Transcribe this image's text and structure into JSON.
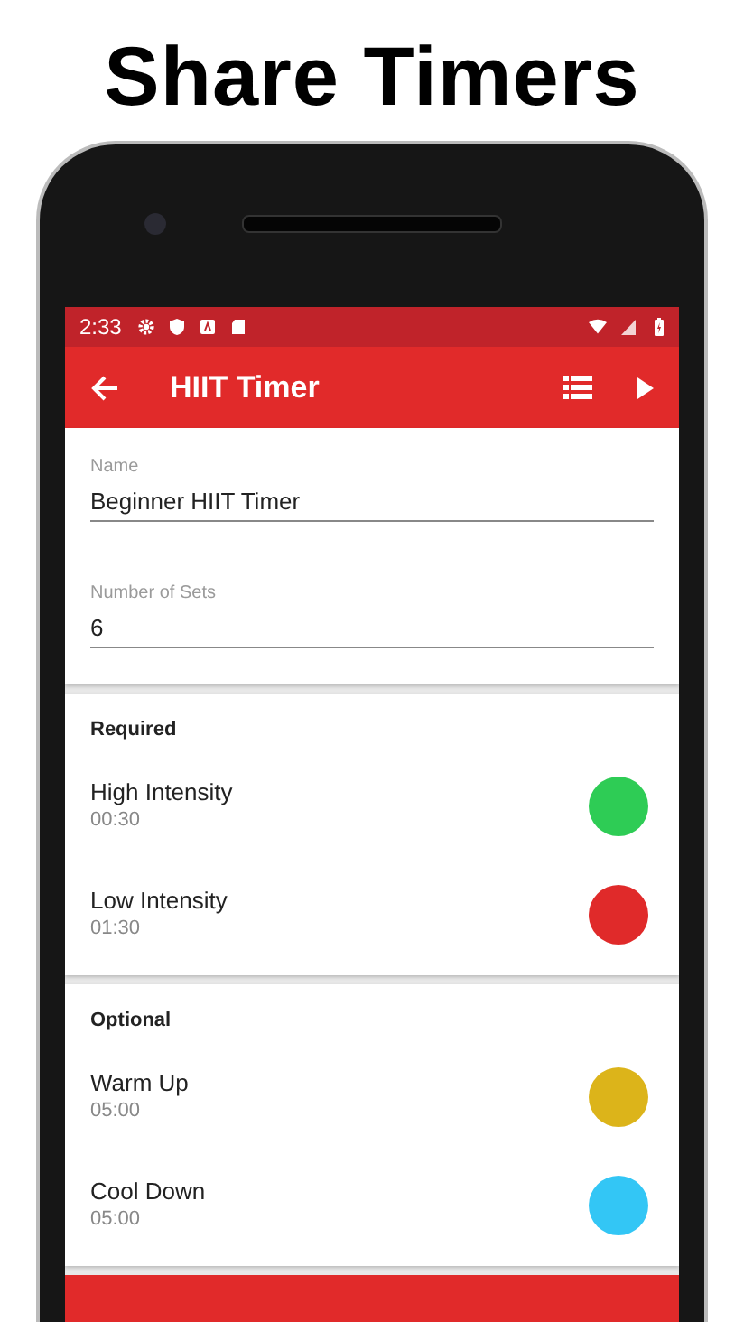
{
  "headline": "Share Timers",
  "status_bar": {
    "time": "2:33"
  },
  "app_bar": {
    "title": "HIIT Timer"
  },
  "fields": [
    {
      "label": "Name",
      "value": "Beginner HIIT Timer"
    },
    {
      "label": "Number of Sets",
      "value": "6"
    }
  ],
  "sections": [
    {
      "title": "Required",
      "items": [
        {
          "name": "High Intensity",
          "time": "00:30",
          "color": "#2ecc55"
        },
        {
          "name": "Low Intensity",
          "time": "01:30",
          "color": "#e02a2a"
        }
      ]
    },
    {
      "title": "Optional",
      "items": [
        {
          "name": "Warm Up",
          "time": "05:00",
          "color": "#dcb41a"
        },
        {
          "name": "Cool Down",
          "time": "05:00",
          "color": "#33c6f5"
        }
      ]
    }
  ]
}
